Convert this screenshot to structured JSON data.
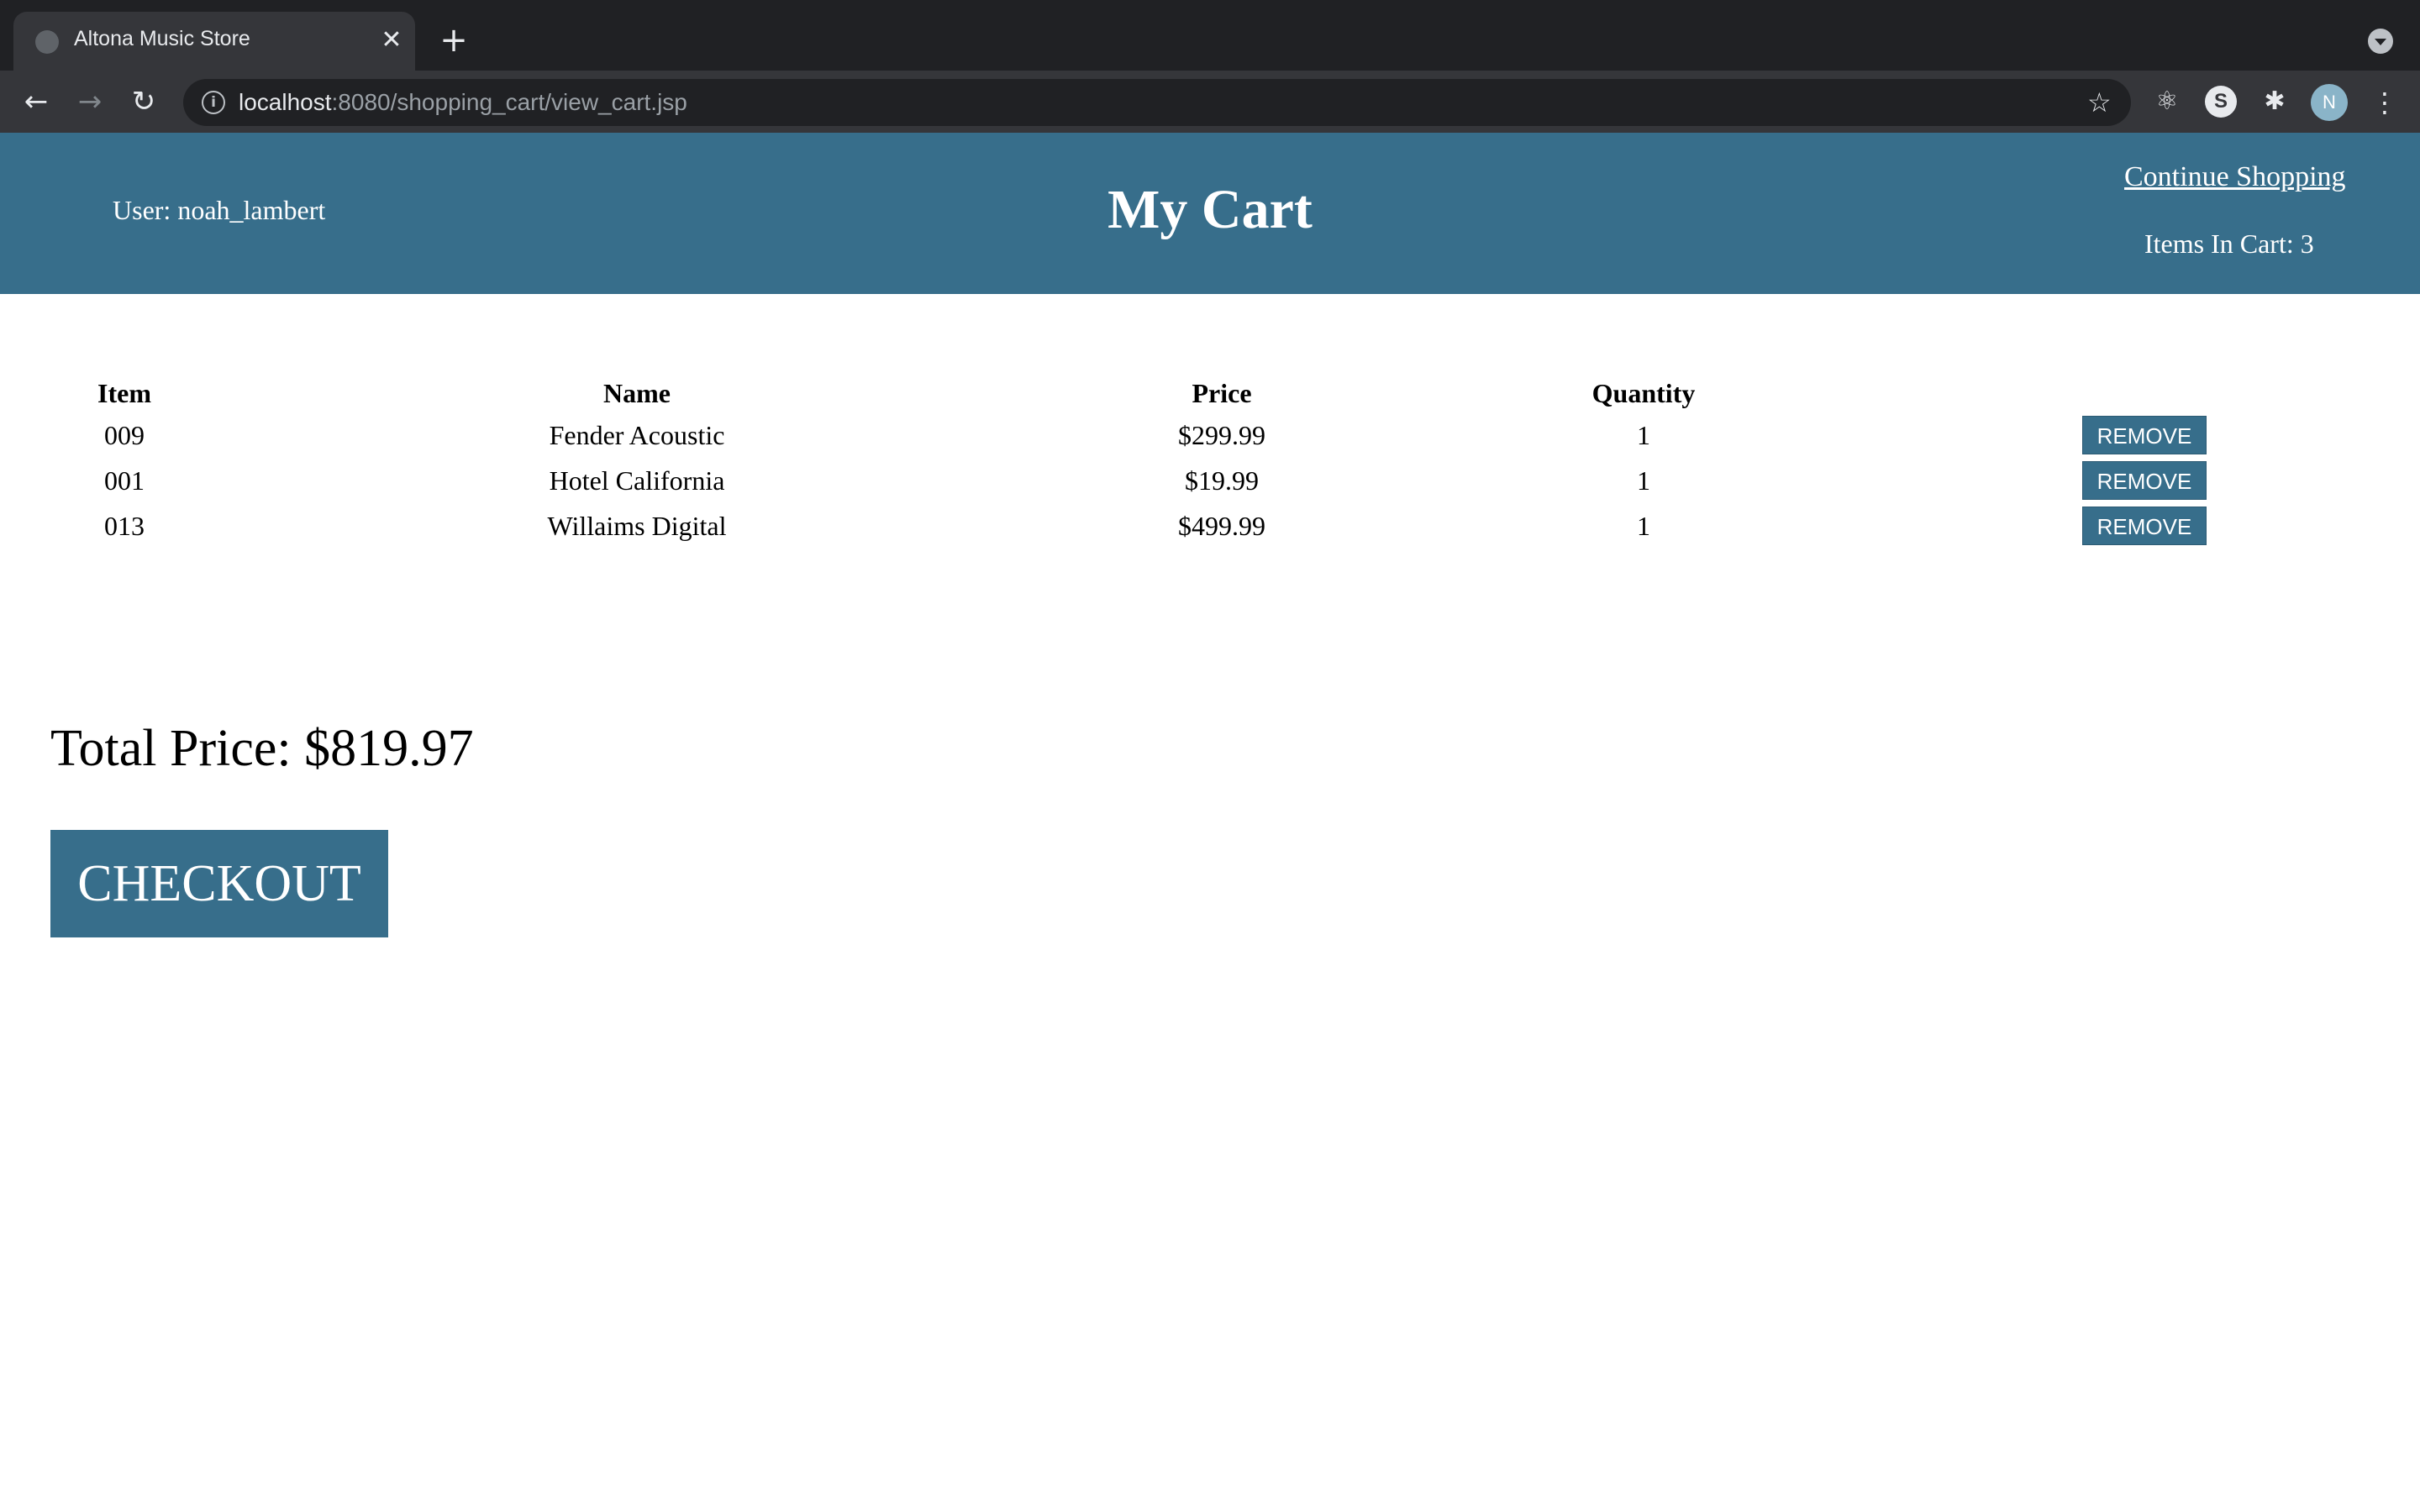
{
  "browser": {
    "tab_title": "Altona Music Store",
    "tab_close_glyph": "✕",
    "new_tab_glyph": "+",
    "url_host": "localhost",
    "url_path": ":8080/shopping_cart/view_cart.jsp",
    "avatar_initial": "N",
    "icons": [
      "globe-icon",
      "close-icon",
      "plus-icon",
      "tab-search-icon",
      "back-arrow-icon",
      "forward-arrow-icon",
      "reload-icon",
      "info-icon",
      "bookmark-star-icon",
      "react-devtools-icon",
      "s-extension-icon",
      "puzzle-extensions-icon",
      "kebab-menu-icon"
    ]
  },
  "header": {
    "user_label": "User: noah_lambert",
    "title": "My Cart",
    "continue_link": "Continue Shopping",
    "items_in_cart": "Items In Cart: 3"
  },
  "table": {
    "headers": [
      "Item",
      "Name",
      "Price",
      "Quantity"
    ],
    "rows": [
      {
        "item": "009",
        "name": "Fender Acoustic",
        "price": "$299.99",
        "quantity": "1",
        "action": "REMOVE"
      },
      {
        "item": "001",
        "name": "Hotel California",
        "price": "$19.99",
        "quantity": "1",
        "action": "REMOVE"
      },
      {
        "item": "013",
        "name": "Willaims Digital",
        "price": "$499.99",
        "quantity": "1",
        "action": "REMOVE"
      }
    ]
  },
  "summary": {
    "total_price": "Total Price: $819.97",
    "checkout_label": "CHECKOUT"
  },
  "colors": {
    "header_bg": "#376e8b",
    "button_bg": "#376e8b",
    "chrome_bg": "#202124"
  }
}
